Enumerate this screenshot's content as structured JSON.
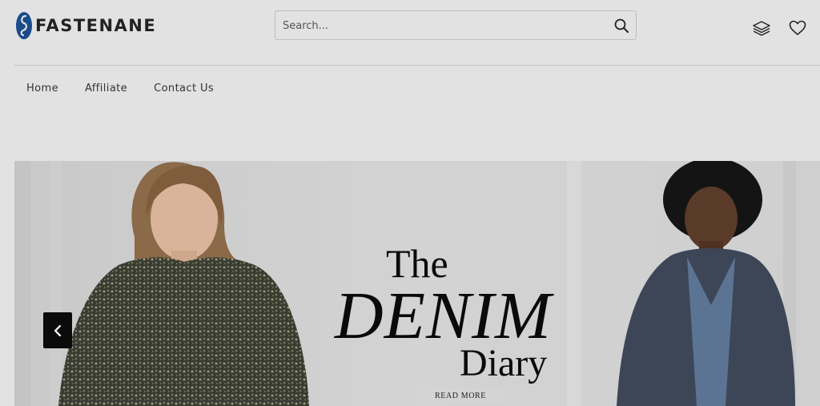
{
  "brand": {
    "name": "FASTENANE"
  },
  "search": {
    "placeholder": "Search...",
    "value": ""
  },
  "nav": {
    "items": [
      {
        "label": "Home"
      },
      {
        "label": "Affiliate"
      },
      {
        "label": "Contact Us"
      }
    ]
  },
  "banner": {
    "line1": "The",
    "line2": "DENIM",
    "line3": "Diary",
    "cta_label": "READ MORE"
  },
  "icons": {
    "logo": "fastenane-logo-icon",
    "search": "search-icon",
    "compare": "layers-icon",
    "wishlist": "heart-icon",
    "prev": "chevron-left-icon"
  },
  "colors": {
    "page_background": "#e2e2e2",
    "text": "#333333",
    "logo_blue": "#1a4c8c",
    "arrow_button": "#0b0b0b"
  }
}
